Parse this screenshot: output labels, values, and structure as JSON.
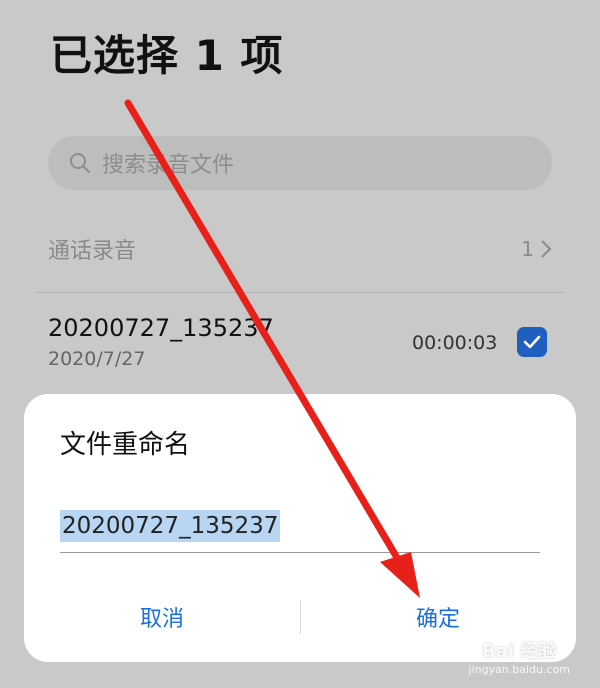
{
  "header": {
    "title": "已选择 1 项"
  },
  "search": {
    "placeholder": "搜索录音文件",
    "icon": "search-icon"
  },
  "section": {
    "title": "通话录音",
    "count": "1"
  },
  "recording": {
    "name": "20200727_135237",
    "date": "2020/7/27",
    "duration": "00:00:03",
    "checked": true
  },
  "dialog": {
    "title": "文件重命名",
    "input_value": "20200727_135237",
    "cancel_label": "取消",
    "confirm_label": "确定"
  },
  "watermark": {
    "brand": "Bai 经验",
    "url": "jingyan.baidu.com"
  },
  "colors": {
    "accent": "#1a6fe0",
    "checkbox": "#1f5fbf",
    "arrow": "#e8201a",
    "selection": "#b8d6f3"
  }
}
